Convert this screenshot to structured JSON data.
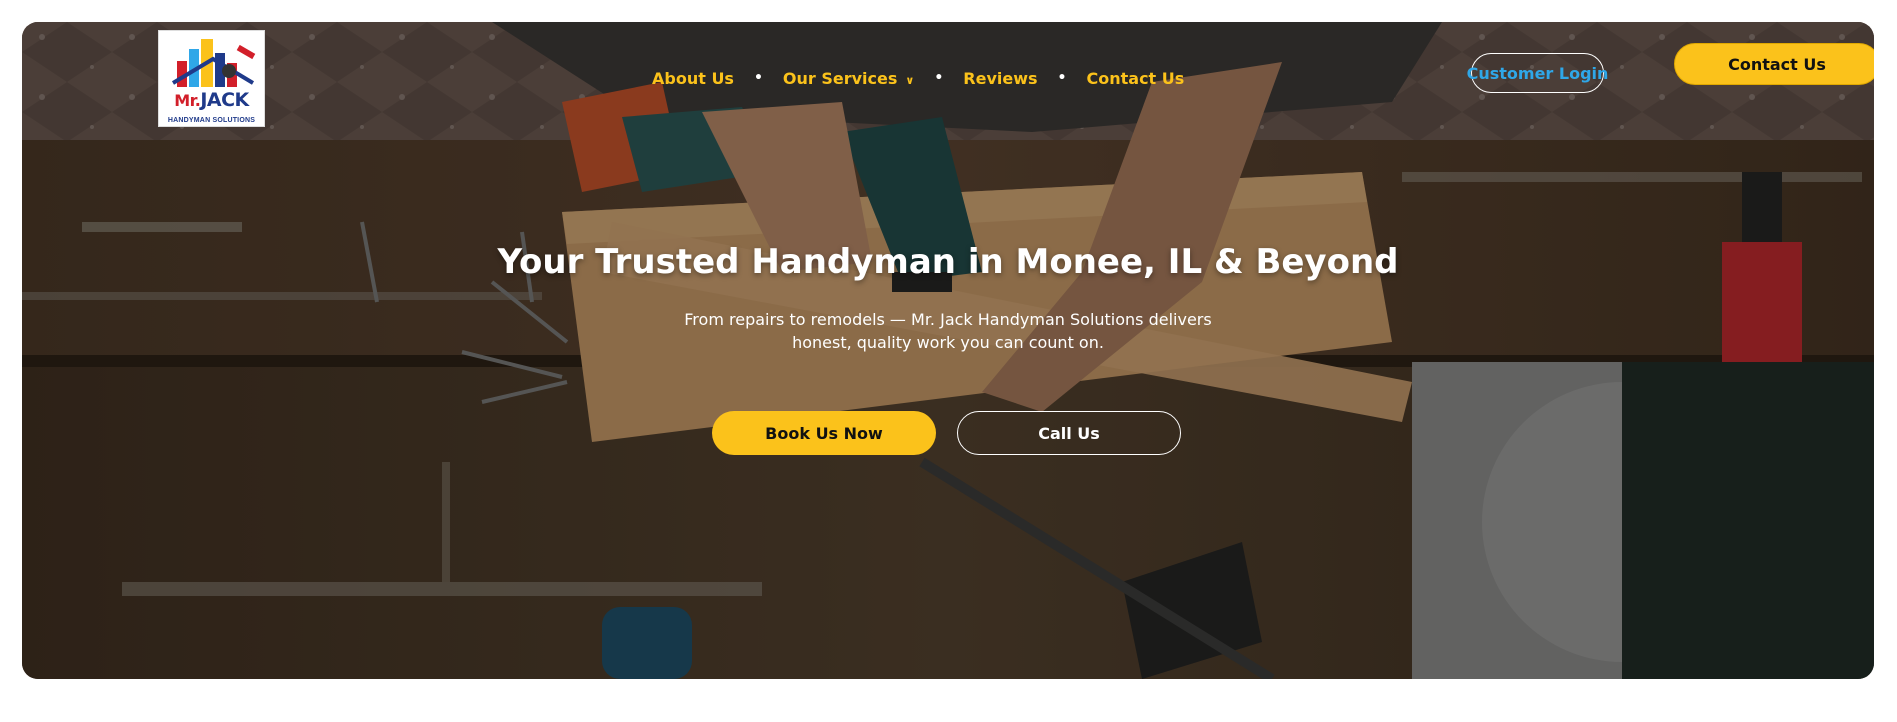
{
  "brand": {
    "logo_primary": "Mr.",
    "logo_name": "JACK",
    "logo_tagline": "HANDYMAN SOLUTIONS"
  },
  "nav": {
    "items": [
      {
        "label": "About Us"
      },
      {
        "label": "Our Services",
        "has_dropdown": true
      },
      {
        "label": "Reviews"
      },
      {
        "label": "Contact Us"
      }
    ]
  },
  "header_actions": {
    "login_label": "Customer Login",
    "contact_label": "Contact Us"
  },
  "hero": {
    "headline": "Your Trusted Handyman in Monee, IL & Beyond",
    "subtext": "From repairs to remodels — Mr. Jack Handyman Solutions delivers honest, quality work you can count on.",
    "primary_cta": "Book Us Now",
    "secondary_cta": "Call Us"
  },
  "colors": {
    "accent_yellow": "#fbc21b",
    "login_blue": "#2fa7e8",
    "logo_red": "#d21f2a",
    "logo_navy": "#1f3a8a"
  },
  "icons": [
    "chevron-down-icon",
    "logo-skyline-icon"
  ]
}
